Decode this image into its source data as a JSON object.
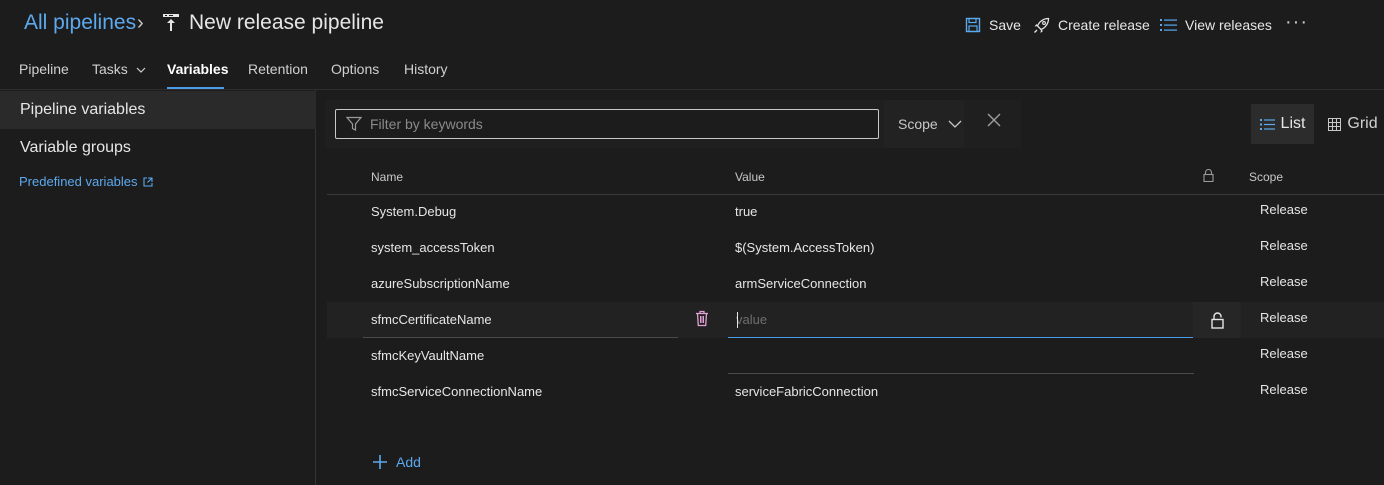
{
  "header": {
    "breadcrumb_link": "All pipelines",
    "breadcrumb_separator": "›",
    "title": "New release pipeline",
    "save_label": "Save",
    "create_release_label": "Create release",
    "view_releases_label": "View releases",
    "more_label": "···"
  },
  "tabs": [
    {
      "label": "Pipeline"
    },
    {
      "label": "Tasks"
    },
    {
      "label": "Variables",
      "active": true
    },
    {
      "label": "Retention"
    },
    {
      "label": "Options"
    },
    {
      "label": "History"
    }
  ],
  "sidebar": {
    "items": [
      {
        "label": "Pipeline variables",
        "selected": true
      },
      {
        "label": "Variable groups"
      }
    ],
    "predefined_link": "Predefined variables"
  },
  "filter": {
    "placeholder": "Filter by keywords",
    "scope_label": "Scope"
  },
  "view_toggle": {
    "list_label": "List",
    "grid_label": "Grid",
    "selected": "List"
  },
  "table": {
    "columns": {
      "name": "Name",
      "value": "Value",
      "scope": "Scope"
    },
    "rows": [
      {
        "name": "System.Debug",
        "value": "true",
        "scope": "Release"
      },
      {
        "name": "system_accessToken",
        "value": "$(System.AccessToken)",
        "scope": "Release"
      },
      {
        "name": "azureSubscriptionName",
        "value": "armServiceConnection",
        "scope": "Release"
      },
      {
        "name": "sfmcCertificateName",
        "value": "",
        "value_placeholder": "value",
        "scope": "Release",
        "editing": true
      },
      {
        "name": "sfmcKeyVaultName",
        "value": "",
        "scope": "Release"
      },
      {
        "name": "sfmcServiceConnectionName",
        "value": "serviceFabricConnection",
        "scope": "Release"
      }
    ]
  },
  "add_label": "Add",
  "colors": {
    "background": "#1c1c1c",
    "accent": "#4c9be8",
    "link": "#5ca9ee",
    "delete_icon": "#e3a2d6"
  }
}
